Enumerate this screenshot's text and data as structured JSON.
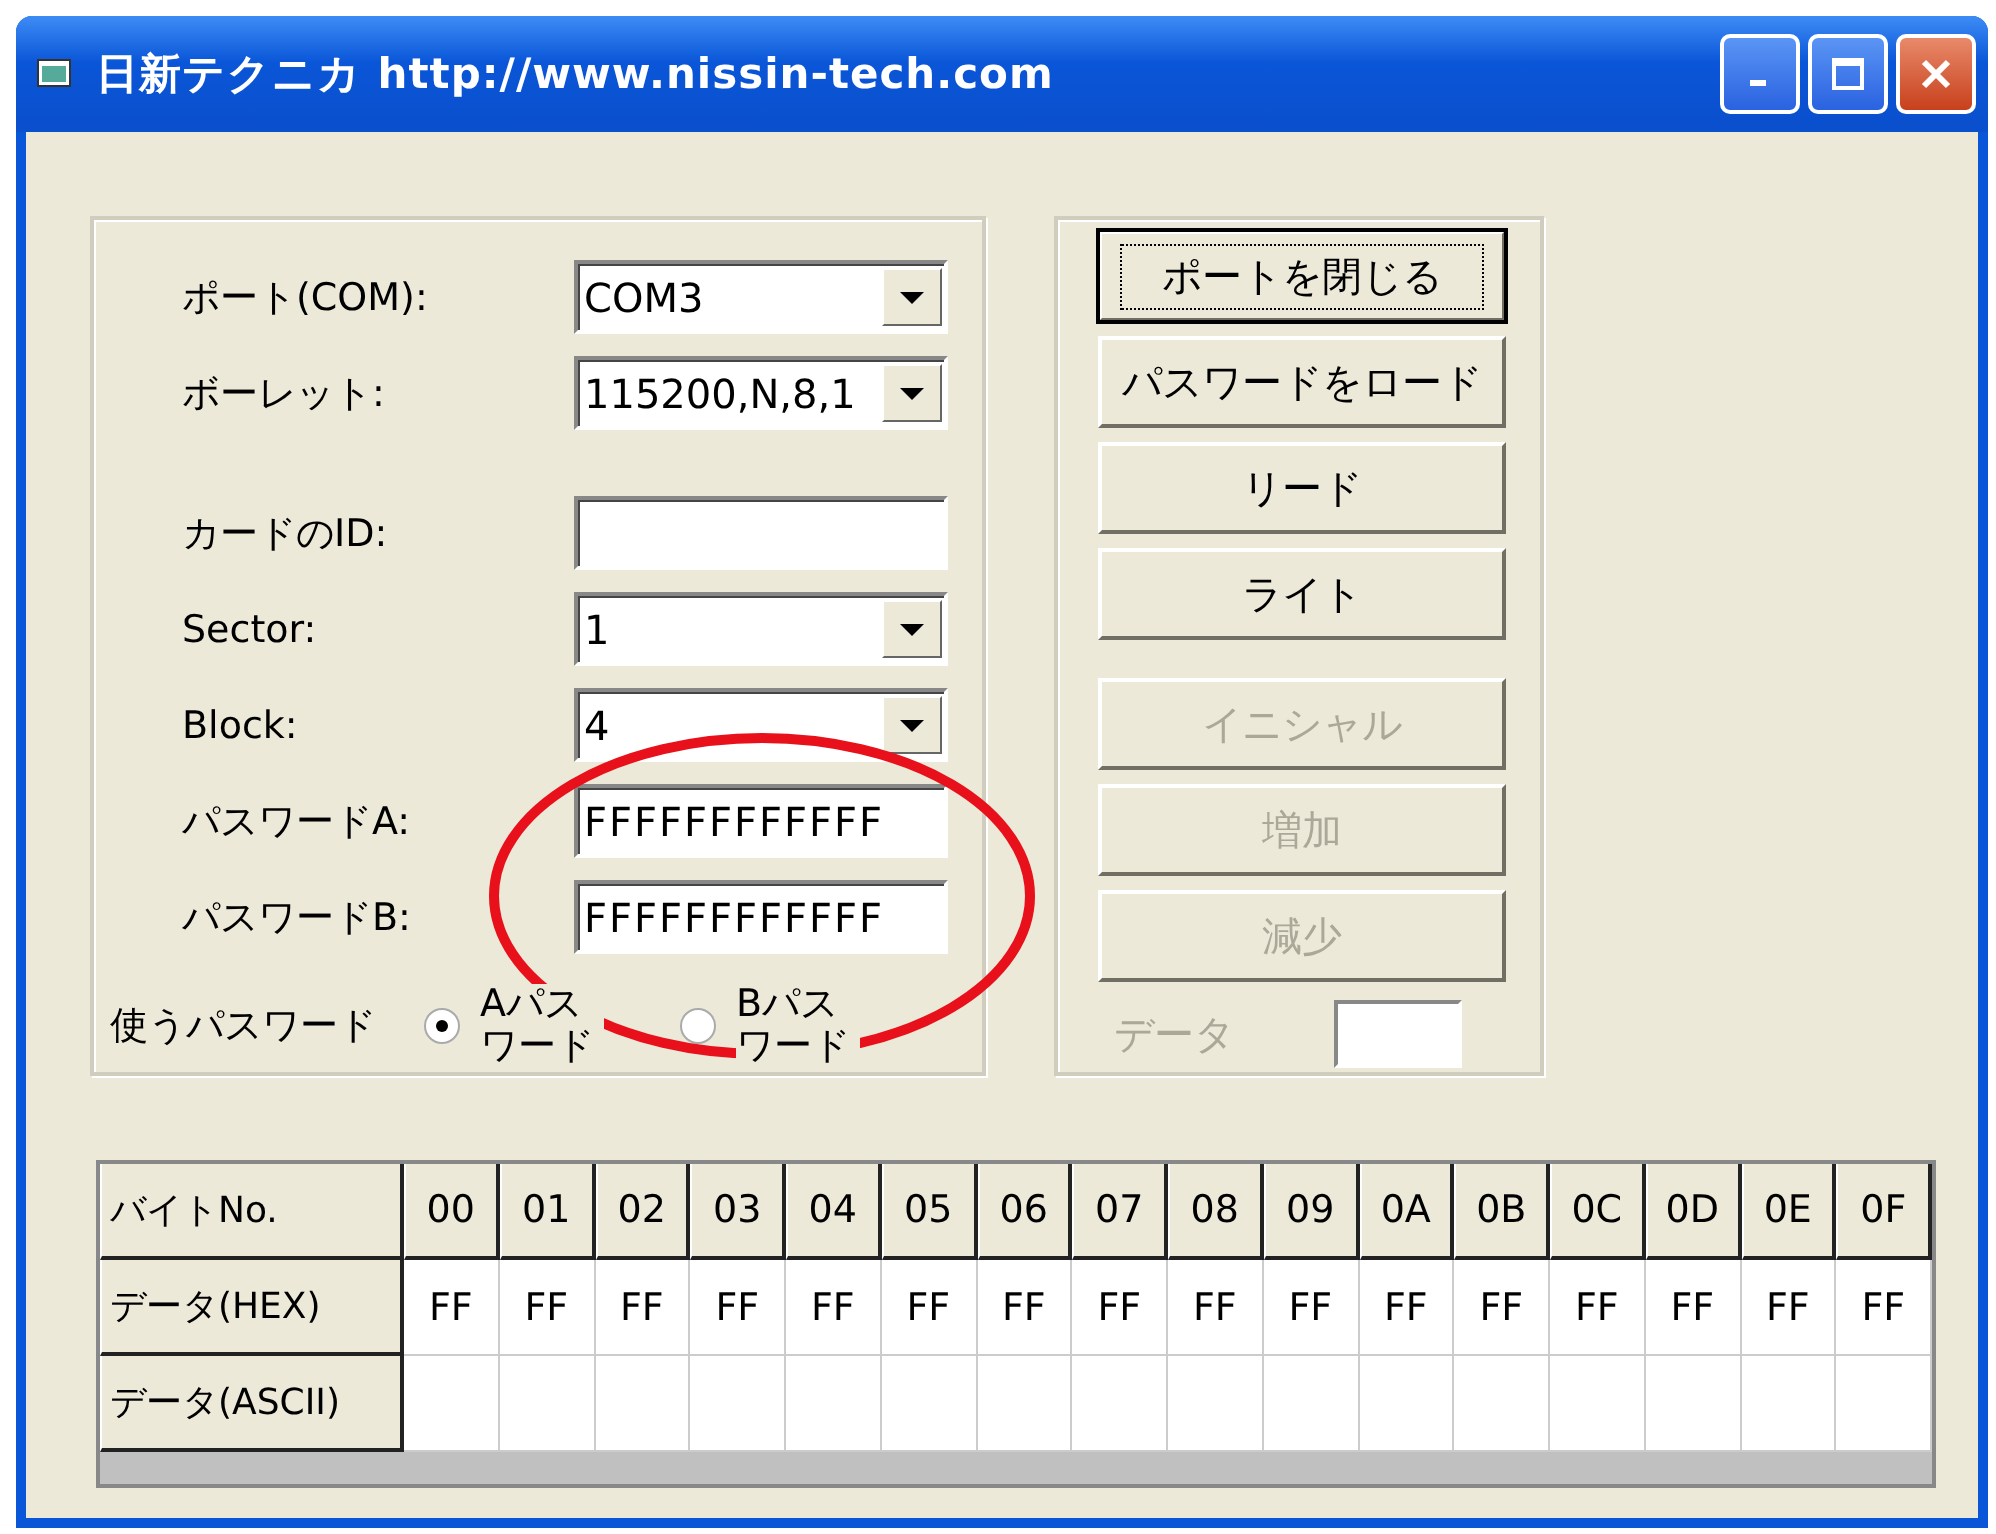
{
  "window": {
    "title": "日新テクニカ http://www.nissin-tech.com"
  },
  "settings": [
    {
      "kind": "combo",
      "label": "ポート(COM):",
      "value": "COM3"
    },
    {
      "kind": "combo",
      "label": "ボーレット:",
      "value": "115200,N,8,1"
    },
    {
      "kind": "text",
      "label": "カードのID:"
    },
    {
      "kind": "combo",
      "label": "Sector:",
      "value": "1"
    },
    {
      "kind": "combo",
      "label": "Block:",
      "value": "4"
    },
    {
      "kind": "text",
      "label": "パスワードA:",
      "value": "FFFFFFFFFFFF"
    },
    {
      "kind": "text",
      "label": "パスワードB:",
      "value": "FFFFFFFFFFFF"
    }
  ],
  "password_choice": {
    "label": "使うパスワード",
    "options": [
      {
        "label": "Aパスワード",
        "selected": true
      },
      {
        "label": "Bパスワード",
        "selected": false
      }
    ]
  },
  "buttons": [
    {
      "label": "ポートを閉じる",
      "disabled": false,
      "focused": true
    },
    {
      "label": "パスワードをロード",
      "disabled": false,
      "focused": false
    },
    {
      "label": "リード",
      "disabled": false,
      "focused": false
    },
    {
      "label": "ライト",
      "disabled": false,
      "focused": false
    },
    {
      "label": "イニシャル",
      "disabled": true,
      "focused": false
    },
    {
      "label": "増加",
      "disabled": true,
      "focused": false
    },
    {
      "label": "減少",
      "disabled": true,
      "focused": false
    }
  ],
  "data_field": {
    "label": "データ",
    "disabled": true
  },
  "table": {
    "columns": [
      "バイトNo.",
      "00",
      "01",
      "02",
      "03",
      "04",
      "05",
      "06",
      "07",
      "08",
      "09",
      "0A",
      "0B",
      "0C",
      "0D",
      "0E",
      "0F"
    ],
    "rows": [
      {
        "header": "データ(HEX)",
        "cells": [
          "FF",
          "FF",
          "FF",
          "FF",
          "FF",
          "FF",
          "FF",
          "FF",
          "FF",
          "FF",
          "FF",
          "FF",
          "FF",
          "FF",
          "FF",
          "FF"
        ]
      },
      {
        "header": "データ(ASCII)"
      }
    ]
  },
  "annotations": [
    {
      "kind": "ellipse"
    }
  ]
}
